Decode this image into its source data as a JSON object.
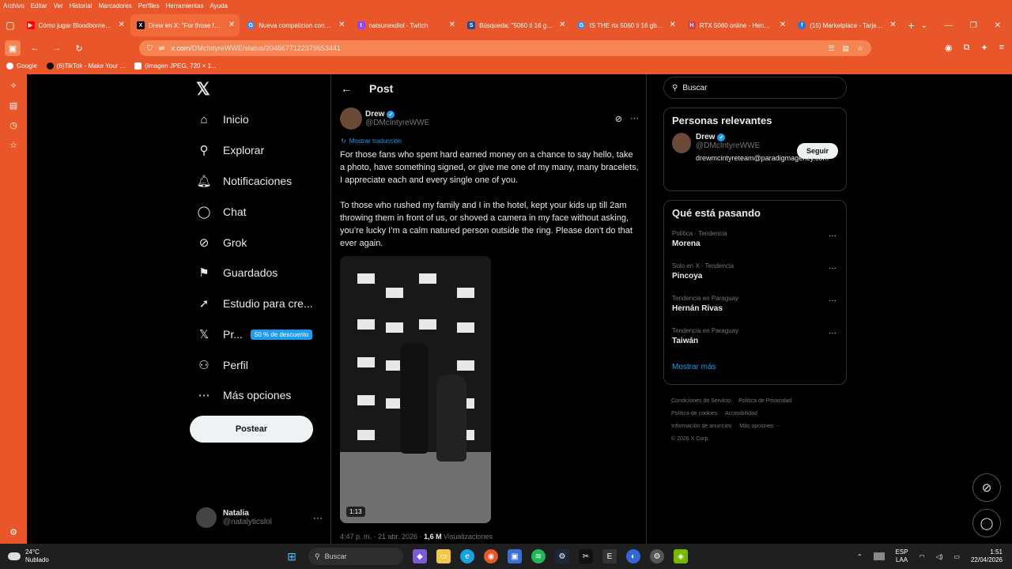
{
  "menubar": [
    "Archivo",
    "Editar",
    "Ver",
    "Historial",
    "Marcadores",
    "Perfiles",
    "Herramientas",
    "Ayuda"
  ],
  "tabs": [
    {
      "title": "Cómo jugar Bloodborne en PC",
      "icon": "youtube-icon",
      "color": "#ff0000",
      "active": false
    },
    {
      "title": "Drew en X: \"For those fans who",
      "icon": "x-icon",
      "color": "#000000",
      "active": true
    },
    {
      "title": "Nueva competicion conmebol -",
      "icon": "google-icon",
      "color": "#4285f4",
      "active": false
    },
    {
      "title": "natsunexdlol - Twitch",
      "icon": "twitch-icon",
      "color": "#9146ff",
      "active": false
    },
    {
      "title": "Búsqueda: \"5060 ti 16 gb\" - Sol",
      "icon": "sd-icon",
      "color": "#1a4fa0",
      "active": false
    },
    {
      "title": "IS THE rtx 5060 ti 16 gb GOOD",
      "icon": "google-icon",
      "color": "#4285f4",
      "active": false
    },
    {
      "title": "RTX 5060 online - Hendyla.com",
      "icon": "hendyla-icon",
      "color": "#e8562a",
      "active": false
    },
    {
      "title": "(15) Marketplace - Tarjeta gráfic",
      "icon": "facebook-icon",
      "color": "#1877f2",
      "active": false
    }
  ],
  "url": {
    "host": "x.com",
    "path": "/DMcIntyreWWE/status/2046677122379653441"
  },
  "bookmarks": [
    "Google",
    "(6)TikTok - Make Your ...",
    "(Imagen JPEG, 720 × 1..."
  ],
  "leftnav": {
    "items": [
      {
        "label": "Inicio",
        "icon": "home-icon"
      },
      {
        "label": "Explorar",
        "icon": "search-icon"
      },
      {
        "label": "Notificaciones",
        "icon": "bell-icon"
      },
      {
        "label": "Chat",
        "icon": "chat-icon"
      },
      {
        "label": "Grok",
        "icon": "grok-icon"
      },
      {
        "label": "Guardados",
        "icon": "bookmark-icon"
      },
      {
        "label": "Estudio para cre...",
        "icon": "rocket-icon"
      },
      {
        "label": "Pr...",
        "icon": "x-icon"
      },
      {
        "label": "Perfil",
        "icon": "person-icon"
      },
      {
        "label": "Más opciones",
        "icon": "more-icon"
      }
    ],
    "premium_badge": "50 % de descuento",
    "post_button": "Postear",
    "account": {
      "name": "Natalia",
      "handle": "@natalyticslol"
    }
  },
  "post": {
    "header": "Post",
    "author": {
      "name": "Drew",
      "handle": "@DMcIntyreWWE"
    },
    "translate": "Mostrar traducción",
    "paragraphs": [
      "For those fans who spent hard earned money on a chance to say hello, take a photo, have something signed, or give me one of my many, many bracelets, I appreciate each and every single one of you.",
      "To those who rushed my family and I in the hotel, kept your kids up till 2am throwing them in front of us, or shoved a camera in my face without asking, you’re lucky I’m a calm natured person outside the ring. Please don’t do that ever again."
    ],
    "video_duration": "1:13",
    "time": "4:47 p. m. · 21 abr. 2026 · ",
    "views_count": "1,6 M",
    "views_label": " Visualizaciones"
  },
  "right": {
    "search_placeholder": "Buscar",
    "relevant_title": "Personas relevantes",
    "relevant": {
      "name": "Drew",
      "handle": "@DMcIntyreWWE",
      "bio": "drewmcintyreteam@paradigmagency.com",
      "follow": "Seguir"
    },
    "trending_title": "Qué está pasando",
    "trends": [
      {
        "context": "Política · Tendencia",
        "name": "Morena"
      },
      {
        "context": "Solo en X · Tendencia",
        "name": "Pincoya"
      },
      {
        "context": "Tendencia en Paraguay",
        "name": "Hernán Rivas"
      },
      {
        "context": "Tendencia en Paraguay",
        "name": "Taiwán"
      }
    ],
    "show_more": "Mostrar más",
    "footer": [
      "Condiciones de Servicio",
      "Política de Privacidad",
      "Política de cookies",
      "Accesibilidad",
      "Información de anuncios",
      "Más opciones ···",
      "© 2026 X Corp."
    ]
  },
  "taskbar": {
    "weather": {
      "temp": "24°C",
      "desc": "Nublado"
    },
    "search": "Buscar",
    "lang": {
      "code": "ESP",
      "layout": "LAA"
    },
    "time": "1:51",
    "date": "22/04/2026"
  },
  "colors": {
    "browser_accent": "#e8562a",
    "x_blue": "#1d9bf0",
    "bg": "#000000"
  }
}
